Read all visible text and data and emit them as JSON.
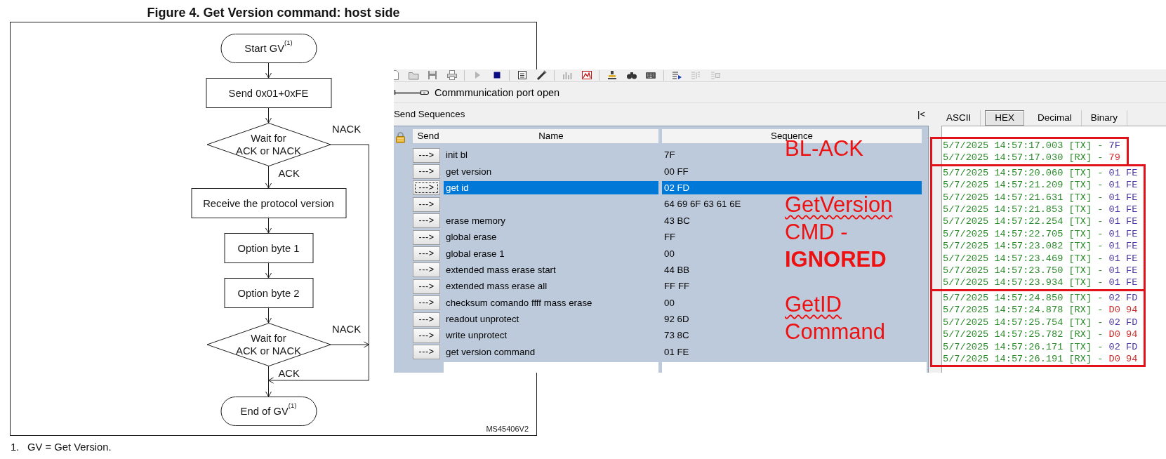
{
  "figure": {
    "title": "Figure 4. Get Version command: host side",
    "nodes": [
      {
        "kind": "terminal",
        "text": "Start GV$^{(1)}$"
      },
      {
        "kind": "process",
        "text": "Send 0x01+0xFE"
      },
      {
        "kind": "decision",
        "text": "Wait for\nACK or NACK",
        "yes_label": "ACK",
        "no_label": "NACK"
      },
      {
        "kind": "process",
        "text": "Receive the protocol version"
      },
      {
        "kind": "process",
        "text": "Option byte 1"
      },
      {
        "kind": "process",
        "text": "Option byte 2"
      },
      {
        "kind": "decision",
        "text": "Wait for\nACK or NACK",
        "yes_label": "ACK",
        "no_label": "NACK"
      },
      {
        "kind": "terminal",
        "text": "End of GV$^{(1)}$"
      }
    ],
    "code": "MS45406V2",
    "footnote": {
      "number": "1.",
      "text": "GV = Get Version."
    }
  },
  "app": {
    "toolbar": [
      {
        "kind": "new",
        "disabled": false
      },
      {
        "kind": "open",
        "disabled": false
      },
      {
        "kind": "save",
        "disabled": false
      },
      {
        "kind": "print",
        "disabled": false
      },
      {
        "kind": "separator"
      },
      {
        "kind": "play",
        "disabled": true
      },
      {
        "kind": "stop",
        "disabled": false
      },
      {
        "kind": "separator"
      },
      {
        "kind": "list",
        "disabled": false
      },
      {
        "kind": "tool",
        "disabled": false
      },
      {
        "kind": "separator"
      },
      {
        "kind": "bars",
        "disabled": true
      },
      {
        "kind": "graph",
        "disabled": false
      },
      {
        "kind": "separator"
      },
      {
        "kind": "stamp",
        "disabled": false
      },
      {
        "kind": "binoculars",
        "disabled": false
      },
      {
        "kind": "keyboard",
        "disabled": false
      },
      {
        "kind": "separator"
      },
      {
        "kind": "send",
        "disabled": false
      },
      {
        "kind": "log",
        "disabled": true
      },
      {
        "kind": "clear",
        "disabled": true
      }
    ],
    "status": "Commmunication port open",
    "sequences": {
      "title": "Send Sequences",
      "collapse_button": "|<",
      "columns": [
        "Send",
        "Name",
        "Sequence"
      ],
      "rows": [
        {
          "button": "--->",
          "name": "init bl",
          "sequence": "7F",
          "selected": false
        },
        {
          "button": "--->",
          "name": "get version",
          "sequence": "00 FF",
          "selected": false
        },
        {
          "button": "--->",
          "name": "get id",
          "sequence": "02 FD",
          "selected": true
        },
        {
          "button": "--->",
          "sequence": "64 69 6F 63 61 6E",
          "selected": false
        },
        {
          "button": "--->",
          "name": "erase memory",
          "sequence": "43 BC",
          "selected": false
        },
        {
          "button": "--->",
          "name": "global erase",
          "sequence": "FF",
          "selected": false
        },
        {
          "button": "--->",
          "name": "global erase 1",
          "sequence": "00",
          "selected": false
        },
        {
          "button": "--->",
          "name": "extended mass erase start",
          "sequence": "44 BB",
          "selected": false
        },
        {
          "button": "--->",
          "name": "extended mass erase all",
          "sequence": "FF FF",
          "selected": false
        },
        {
          "button": "--->",
          "name": "checksum comando ffff mass erase",
          "sequence": "00",
          "selected": false
        },
        {
          "button": "--->",
          "name": "readout unprotect",
          "sequence": "92 6D",
          "selected": false
        },
        {
          "button": "--->",
          "name": "write unprotect",
          "sequence": "73 8C",
          "selected": false
        },
        {
          "button": "--->",
          "name": "get version command",
          "sequence": "01 FE",
          "selected": false
        }
      ]
    },
    "view_tabs": [
      {
        "label": "ASCII",
        "selected": false
      },
      {
        "label": "HEX",
        "selected": true
      },
      {
        "label": "Decimal",
        "selected": false
      },
      {
        "label": "Binary",
        "selected": false
      }
    ],
    "log": [
      {
        "highlighted": true,
        "lines": [
          {
            "kind": "tx",
            "text": "5/7/2025 14:57:17.003 [TX] -",
            "data": "7F"
          },
          {
            "kind": "rx",
            "text": "5/7/2025 14:57:17.030 [RX] -",
            "data": "79"
          }
        ]
      },
      {
        "highlighted": true,
        "lines": [
          {
            "kind": "tx",
            "text": "5/7/2025 14:57:20.060 [TX] -",
            "data": "01 FE"
          },
          {
            "kind": "tx",
            "text": "5/7/2025 14:57:21.209 [TX] -",
            "data": "01 FE"
          },
          {
            "kind": "tx",
            "text": "5/7/2025 14:57:21.631 [TX] -",
            "data": "01 FE"
          },
          {
            "kind": "tx",
            "text": "5/7/2025 14:57:21.853 [TX] -",
            "data": "01 FE"
          },
          {
            "kind": "tx",
            "text": "5/7/2025 14:57:22.254 [TX] -",
            "data": "01 FE"
          },
          {
            "kind": "tx",
            "text": "5/7/2025 14:57:22.705 [TX] -",
            "data": "01 FE"
          },
          {
            "kind": "tx",
            "text": "5/7/2025 14:57:23.082 [TX] -",
            "data": "01 FE"
          },
          {
            "kind": "tx",
            "text": "5/7/2025 14:57:23.469 [TX] -",
            "data": "01 FE"
          },
          {
            "kind": "tx",
            "text": "5/7/2025 14:57:23.750 [TX] -",
            "data": "01 FE"
          },
          {
            "kind": "tx",
            "text": "5/7/2025 14:57:23.934 [TX] -",
            "data": "01 FE"
          }
        ]
      },
      {
        "highlighted": true,
        "lines": [
          {
            "kind": "tx",
            "text": "5/7/2025 14:57:24.850 [TX] -",
            "data": "02 FD"
          },
          {
            "kind": "rx",
            "text": "5/7/2025 14:57:24.878 [RX] -",
            "data": "D0 94"
          },
          {
            "kind": "tx",
            "text": "5/7/2025 14:57:25.754 [TX] -",
            "data": "02 FD"
          },
          {
            "kind": "rx",
            "text": "5/7/2025 14:57:25.782 [RX] -",
            "data": "D0 94"
          },
          {
            "kind": "tx",
            "text": "5/7/2025 14:57:26.171 [TX] -",
            "data": "02 FD"
          },
          {
            "kind": "rx",
            "text": "5/7/2025 14:57:26.191 [RX] -",
            "data": "D0 94"
          }
        ]
      }
    ]
  },
  "annotations": [
    {
      "lines": [
        {
          "text": "BL-ACK",
          "bold": false,
          "flagged": false
        }
      ]
    },
    {
      "lines": [
        {
          "text": "GetVersion",
          "bold": false,
          "flagged": true
        },
        {
          "text": "CMD -",
          "bold": false,
          "flagged": false
        },
        {
          "text": "IGNORED",
          "bold": true,
          "flagged": false
        }
      ]
    },
    {
      "lines": [
        {
          "text": "GetID",
          "bold": false,
          "flagged": true
        },
        {
          "text": "Command",
          "bold": false,
          "flagged": false
        }
      ]
    }
  ]
}
